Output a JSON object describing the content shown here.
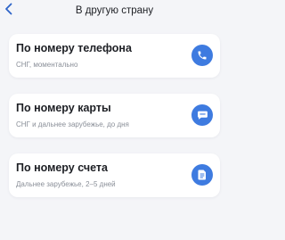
{
  "header": {
    "title": "В другую страну"
  },
  "options": [
    {
      "title": "По номеру телефона",
      "subtitle": "СНГ, моментально",
      "icon": "phone-icon"
    },
    {
      "title": "По номеру карты",
      "subtitle": "СНГ и дальнее зарубежье, до дня",
      "icon": "chat-icon"
    },
    {
      "title": "По номеру счета",
      "subtitle": "Дальнее зарубежье, 2–5 дней",
      "icon": "document-icon"
    }
  ],
  "colors": {
    "accent": "#3e7be0",
    "background": "#f4f5f8",
    "card": "#ffffff",
    "subtitle": "#8a8f98"
  }
}
